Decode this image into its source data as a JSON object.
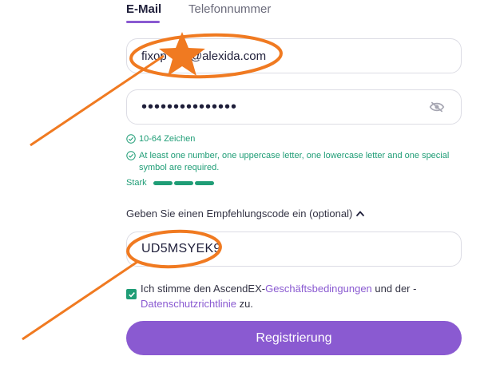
{
  "tabs": {
    "email_label": "E-Mail",
    "phone_label": "Telefonnummer"
  },
  "email": {
    "value": "fixop     1@alexida.com"
  },
  "password": {
    "value": "•••••••••••••••",
    "visibility_icon": "eye-icon"
  },
  "rules": {
    "length": "10-64 Zeichen",
    "complexity": "At least one number, one uppercase letter, one lowercase letter and one special symbol are required."
  },
  "strength": {
    "label": "Stark",
    "level": 1.0
  },
  "referral": {
    "toggle_label": "Geben Sie einen Empfehlungscode ein (optional)",
    "value": "UD5MSYEK9"
  },
  "consent": {
    "prefix": "Ich stimme den AscendEX-",
    "terms_link": "Geschäftsbedingungen",
    "middle": " und der -",
    "privacy_link": "Datenschutzrichtlinie",
    "suffix": " zu.",
    "checked": true
  },
  "register_button": {
    "label": "Registrierung"
  },
  "colors": {
    "accent": "#8a5ad1",
    "success": "#1f9d76",
    "annotation": "#f07a21"
  }
}
